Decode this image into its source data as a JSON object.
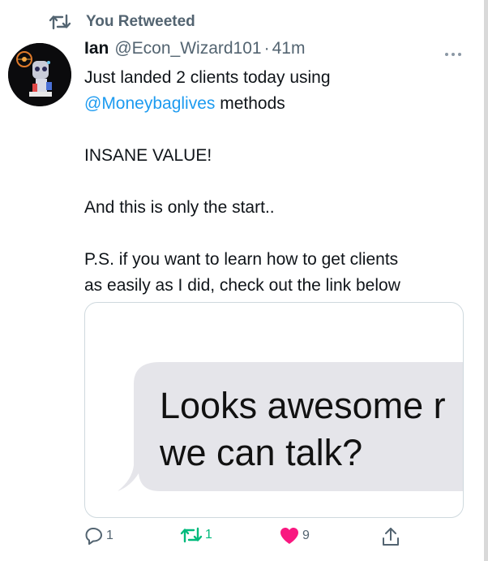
{
  "retweet_context": {
    "label": "You Retweeted",
    "icon": "retweet-icon"
  },
  "tweet": {
    "author_name": "Ian",
    "author_handle": "@Econ_Wizard101",
    "separator": "·",
    "timestamp": "41m",
    "lines": {
      "line1": "Just landed 2 clients today using",
      "mention": "@Moneybaglives",
      "line2_rest": " methods",
      "line3": "INSANE VALUE!",
      "line4": "And this is only the start..",
      "line5": "P.S. if you want to learn how to get clients",
      "line6": "as easily as I did, check out the link below"
    },
    "media": {
      "bubble_line1": "Looks awesome r",
      "bubble_line2": "we can talk?"
    },
    "actions": {
      "reply_count": "1",
      "retweet_count": "1",
      "like_count": "9"
    }
  },
  "colors": {
    "accent_blue": "#1d9bf0",
    "retweet_green": "#00ba7c",
    "like_red": "#f91880",
    "muted_gray": "#536471",
    "bubble_gray": "#e5e5ea"
  }
}
